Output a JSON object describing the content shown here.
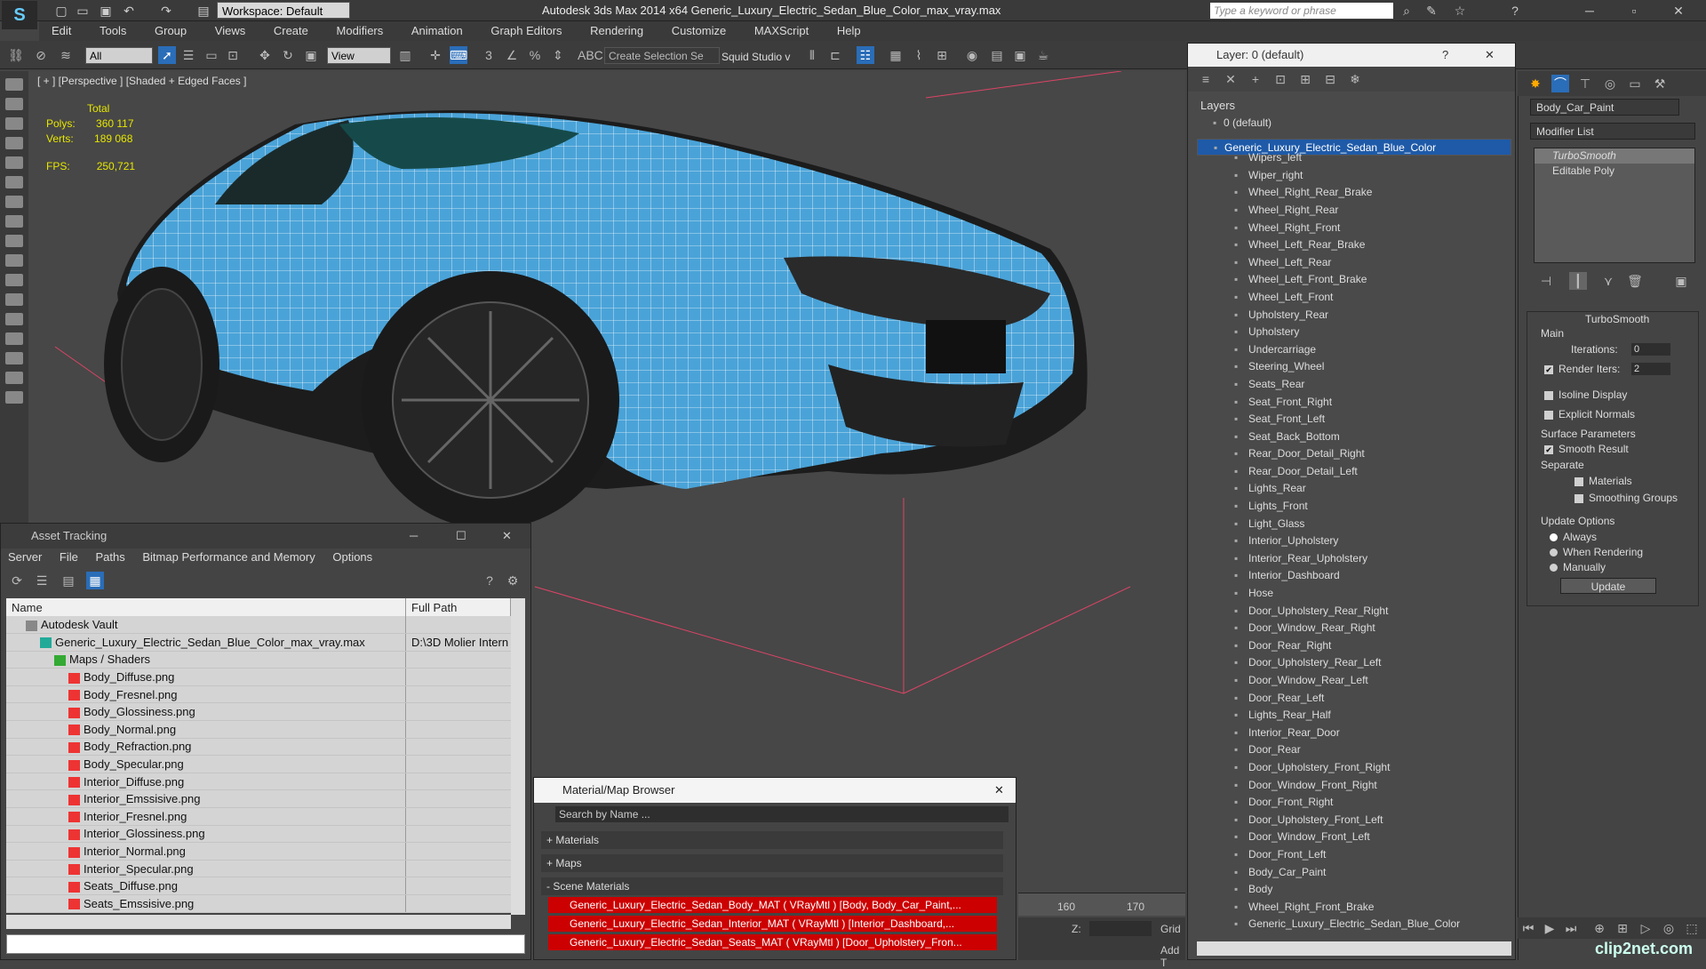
{
  "app": {
    "title": "Autodesk 3ds Max  2014 x64     Generic_Luxury_Electric_Sedan_Blue_Color_max_vray.max",
    "workspace": "Workspace: Default",
    "search_placeholder": "Type a keyword or phrase"
  },
  "menu": [
    "Edit",
    "Tools",
    "Group",
    "Views",
    "Create",
    "Modifiers",
    "Animation",
    "Graph Editors",
    "Rendering",
    "Customize",
    "MAXScript",
    "Help"
  ],
  "toolbar": {
    "filter": "All",
    "view": "View",
    "selection_set": "Create Selection Se",
    "squid": "Squid Studio v"
  },
  "viewport": {
    "label": "[ + ] [Perspective ] [Shaded + Edged Faces ]",
    "total_label": "Total",
    "polys_label": "Polys:",
    "polys": "360 117",
    "verts_label": "Verts:",
    "verts": "189 068",
    "fps_label": "FPS:",
    "fps": "250,721"
  },
  "asset_tracking": {
    "title": "Asset Tracking",
    "menu": [
      "Server",
      "File",
      "Paths",
      "Bitmap Performance and Memory",
      "Options"
    ],
    "col_name": "Name",
    "col_path": "Full Path",
    "rows": [
      {
        "name": "Autodesk Vault",
        "path": "",
        "level": 0,
        "icon": "vault"
      },
      {
        "name": "Generic_Luxury_Electric_Sedan_Blue_Color_max_vray.max",
        "path": "D:\\3D Molier Intern",
        "level": 1,
        "icon": "max"
      },
      {
        "name": "Maps / Shaders",
        "path": "",
        "level": 2,
        "icon": "folder"
      },
      {
        "name": "Body_Diffuse.png",
        "path": "",
        "level": 3,
        "icon": "png"
      },
      {
        "name": "Body_Fresnel.png",
        "path": "",
        "level": 3,
        "icon": "png"
      },
      {
        "name": "Body_Glossiness.png",
        "path": "",
        "level": 3,
        "icon": "png"
      },
      {
        "name": "Body_Normal.png",
        "path": "",
        "level": 3,
        "icon": "png"
      },
      {
        "name": "Body_Refraction.png",
        "path": "",
        "level": 3,
        "icon": "png"
      },
      {
        "name": "Body_Specular.png",
        "path": "",
        "level": 3,
        "icon": "png"
      },
      {
        "name": "Interior_Diffuse.png",
        "path": "",
        "level": 3,
        "icon": "png"
      },
      {
        "name": "Interior_Emssisive.png",
        "path": "",
        "level": 3,
        "icon": "png"
      },
      {
        "name": "Interior_Fresnel.png",
        "path": "",
        "level": 3,
        "icon": "png"
      },
      {
        "name": "Interior_Glossiness.png",
        "path": "",
        "level": 3,
        "icon": "png"
      },
      {
        "name": "Interior_Normal.png",
        "path": "",
        "level": 3,
        "icon": "png"
      },
      {
        "name": "Interior_Specular.png",
        "path": "",
        "level": 3,
        "icon": "png"
      },
      {
        "name": "Seats_Diffuse.png",
        "path": "",
        "level": 3,
        "icon": "png"
      },
      {
        "name": "Seats_Emssisive.png",
        "path": "",
        "level": 3,
        "icon": "png"
      }
    ]
  },
  "material_browser": {
    "title": "Material/Map Browser",
    "search": "Search by Name ...",
    "materials": "+ Materials",
    "maps": "+ Maps",
    "scene": "- Scene Materials",
    "items": [
      "Generic_Luxury_Electric_Sedan_Body_MAT ( VRayMtl ) [Body, Body_Car_Paint,...",
      "Generic_Luxury_Electric_Sedan_Interior_MAT ( VRayMtl ) [Interior_Dashboard,...",
      "Generic_Luxury_Electric_Sedan_Seats_MAT ( VRayMtl ) [Door_Upholstery_Fron..."
    ]
  },
  "timeline": {
    "t160": "160",
    "t170": "170",
    "z": "Z:",
    "grid": "Grid",
    "add": "Add T"
  },
  "layers": {
    "title": "Layer: 0 (default)",
    "header": "Layers",
    "default": "0 (default)",
    "selected": "Generic_Luxury_Electric_Sedan_Blue_Color",
    "items": [
      "Wipers_left",
      "Wiper_right",
      "Wheel_Right_Rear_Brake",
      "Wheel_Right_Rear",
      "Wheel_Right_Front",
      "Wheel_Left_Rear_Brake",
      "Wheel_Left_Rear",
      "Wheel_Left_Front_Brake",
      "Wheel_Left_Front",
      "Upholstery_Rear",
      "Upholstery",
      "Undercarriage",
      "Steering_Wheel",
      "Seats_Rear",
      "Seat_Front_Right",
      "Seat_Front_Left",
      "Seat_Back_Bottom",
      "Rear_Door_Detail_Right",
      "Rear_Door_Detail_Left",
      "Lights_Rear",
      "Lights_Front",
      "Light_Glass",
      "Interior_Upholstery",
      "Interior_Rear_Upholstery",
      "Interior_Dashboard",
      "Hose",
      "Door_Upholstery_Rear_Right",
      "Door_Window_Rear_Right",
      "Door_Rear_Right",
      "Door_Upholstery_Rear_Left",
      "Door_Window_Rear_Left",
      "Door_Rear_Left",
      "Lights_Rear_Half",
      "Interior_Rear_Door",
      "Door_Rear",
      "Door_Upholstery_Front_Right",
      "Door_Window_Front_Right",
      "Door_Front_Right",
      "Door_Upholstery_Front_Left",
      "Door_Window_Front_Left",
      "Door_Front_Left",
      "Body_Car_Paint",
      "Body",
      "Wheel_Right_Front_Brake",
      "Generic_Luxury_Electric_Sedan_Blue_Color"
    ]
  },
  "modifier": {
    "object": "Body_Car_Paint",
    "list": "Modifier List",
    "stack": [
      "TurboSmooth",
      "Editable Poly"
    ],
    "rollout": "TurboSmooth",
    "main": "Main",
    "iterations_label": "Iterations:",
    "iterations": "0",
    "render_iters_label": "Render Iters:",
    "render_iters": "2",
    "isoline": "Isoline Display",
    "explicit": "Explicit Normals",
    "surface": "Surface Parameters",
    "smooth": "Smooth Result",
    "separate": "Separate",
    "materials": "Materials",
    "smoothing": "Smoothing Groups",
    "update_opts": "Update Options",
    "always": "Always",
    "when_render": "When Rendering",
    "manually": "Manually",
    "update_btn": "Update"
  },
  "watermark": "clip2net.com",
  "colors": {
    "accent": "#1e5aa8",
    "car": "#4aa3d8",
    "alert": "#cc0000"
  }
}
